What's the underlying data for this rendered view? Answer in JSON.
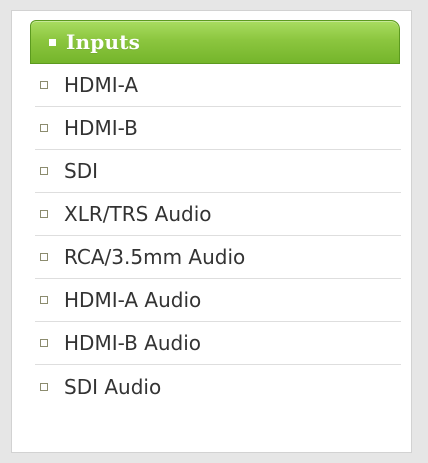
{
  "menu": {
    "title": "Inputs",
    "items": [
      "HDMI-A",
      "HDMI-B",
      "SDI",
      "XLR/TRS Audio",
      "RCA/3.5mm Audio",
      "HDMI-A Audio",
      "HDMI-B Audio",
      "SDI Audio"
    ]
  },
  "colors": {
    "header_green": "#8cc63f",
    "header_text": "#ffffff",
    "item_text": "#333333",
    "divider": "#dedede"
  }
}
